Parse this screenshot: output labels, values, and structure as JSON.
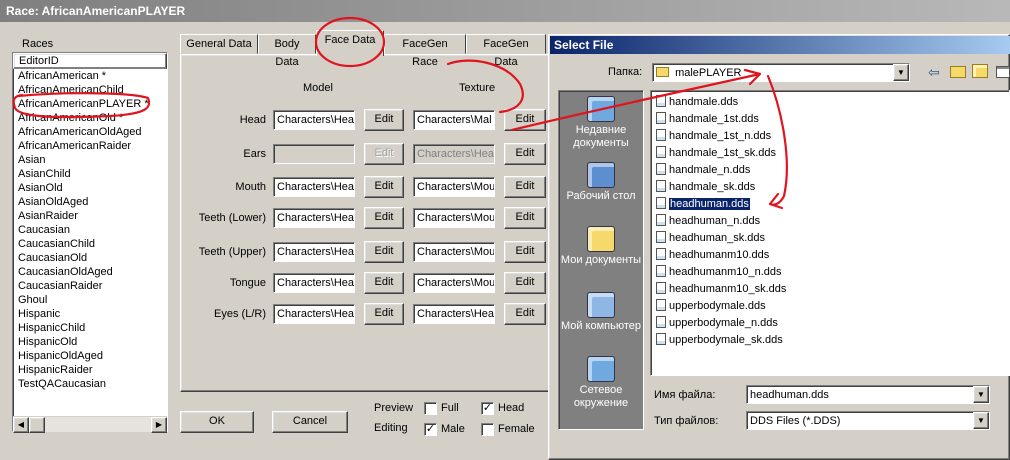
{
  "window": {
    "title": "Race: AfricanAmericanPLAYER"
  },
  "races": {
    "group_label": "Races",
    "column": "EditorID",
    "items": [
      "AfricanAmerican *",
      "AfricanAmericanChild",
      "AfricanAmericanPLAYER *",
      "AfricanAmericanOld *",
      "AfricanAmericanOldAged",
      "AfricanAmericanRaider",
      "Asian",
      "AsianChild",
      "AsianOld",
      "AsianOldAged",
      "AsianRaider",
      "Caucasian",
      "CaucasianChild",
      "CaucasianOld",
      "CaucasianOldAged",
      "CaucasianRaider",
      "Ghoul",
      "Hispanic",
      "HispanicChild",
      "HispanicOld",
      "HispanicOldAged",
      "HispanicRaider",
      "TestQACaucasian"
    ],
    "scroll_left": "◀",
    "scroll_right": "▶"
  },
  "tabs": [
    "General Data",
    "Body Data",
    "Face Data",
    "FaceGen Race",
    "FaceGen Data"
  ],
  "face": {
    "model_header": "Model",
    "texture_header": "Texture",
    "rows": [
      {
        "label": "Head",
        "model": "Characters\\Hea",
        "texture": "Characters\\Mal"
      },
      {
        "label": "Ears",
        "model": "",
        "texture": "Characters\\Hea"
      },
      {
        "label": "Mouth",
        "model": "Characters\\Hea",
        "texture": "Characters\\Mou"
      },
      {
        "label": "Teeth (Lower)",
        "model": "Characters\\Hea",
        "texture": "Characters\\Mou"
      },
      {
        "label": "Teeth (Upper)",
        "model": "Characters\\Hea",
        "texture": "Characters\\Mou"
      },
      {
        "label": "Tongue",
        "model": "Characters\\Hea",
        "texture": "Characters\\Mou"
      },
      {
        "label": "Eyes (L/R)",
        "model": "Characters\\Hea",
        "texture": "Characters\\Hea"
      }
    ],
    "edit_label": "Edit"
  },
  "bottom": {
    "ok": "OK",
    "cancel": "Cancel",
    "preview_label": "Preview",
    "editing_label": "Editing",
    "full": "Full",
    "head": "Head",
    "male": "Male",
    "female": "Female",
    "check_mark": "✓"
  },
  "dialog": {
    "title": "Select File",
    "folder_label": "Папка:",
    "folder": "malePLAYER",
    "places": [
      {
        "icon": "recent-docs-icon",
        "label": "Недавние документы"
      },
      {
        "icon": "desktop-icon",
        "label": "Рабочий стол"
      },
      {
        "icon": "my-documents-icon",
        "label": "Мои документы"
      },
      {
        "icon": "my-computer-icon",
        "label": "Мой компьютер"
      },
      {
        "icon": "network-icon",
        "label": "Сетевое окружение"
      }
    ],
    "files": [
      "handmale.dds",
      "handmale_1st.dds",
      "handmale_1st_n.dds",
      "handmale_1st_sk.dds",
      "handmale_n.dds",
      "handmale_sk.dds",
      "headhuman.dds",
      "headhuman_n.dds",
      "headhuman_sk.dds",
      "headhumanm10.dds",
      "headhumanm10_n.dds",
      "headhumanm10_sk.dds",
      "upperbodymale.dds",
      "upperbodymale_n.dds",
      "upperbodymale_sk.dds"
    ],
    "selected_file": "headhuman.dds",
    "filename_label": "Имя файла:",
    "filename": "headhuman.dds",
    "filetype_label": "Тип файлов:",
    "filetype": "DDS Files (*.DDS)",
    "dropdown_arrow": "▼",
    "back_arrow": "⇦"
  },
  "colors": {
    "annotation": "#e0141e",
    "selection": "#0a246a",
    "dialog_title": "#0a246a"
  }
}
